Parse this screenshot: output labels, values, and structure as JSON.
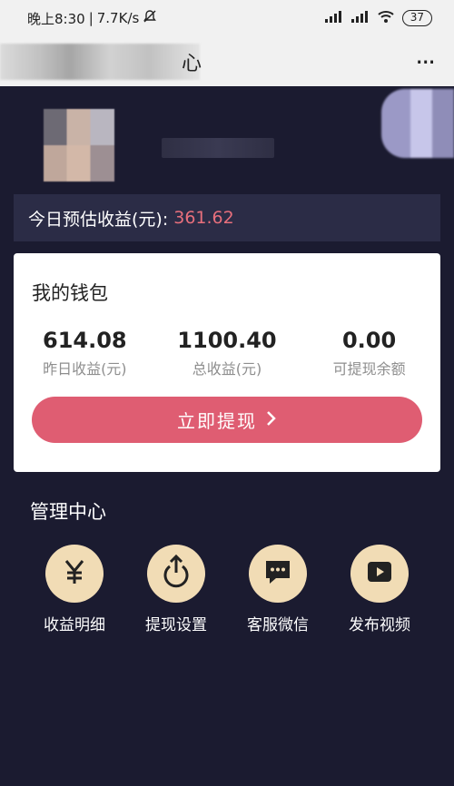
{
  "status_bar": {
    "time": "晚上8:30",
    "speed": "7.7K/s",
    "battery": "37"
  },
  "title_bar": {
    "title_visible": "心"
  },
  "today": {
    "label": "今日预估收益(元):",
    "value": "361.62"
  },
  "wallet": {
    "title": "我的钱包",
    "stats": [
      {
        "value": "614.08",
        "label": "昨日收益(元)"
      },
      {
        "value": "1100.40",
        "label": "总收益(元)"
      },
      {
        "value": "0.00",
        "label": "可提现余额"
      }
    ],
    "withdraw_label": "立即提现"
  },
  "management": {
    "title": "管理中心",
    "items": [
      {
        "label": "收益明细",
        "icon": "yen-icon"
      },
      {
        "label": "提现设置",
        "icon": "power-icon"
      },
      {
        "label": "客服微信",
        "icon": "chat-icon"
      },
      {
        "label": "发布视频",
        "icon": "play-video-icon"
      }
    ]
  }
}
